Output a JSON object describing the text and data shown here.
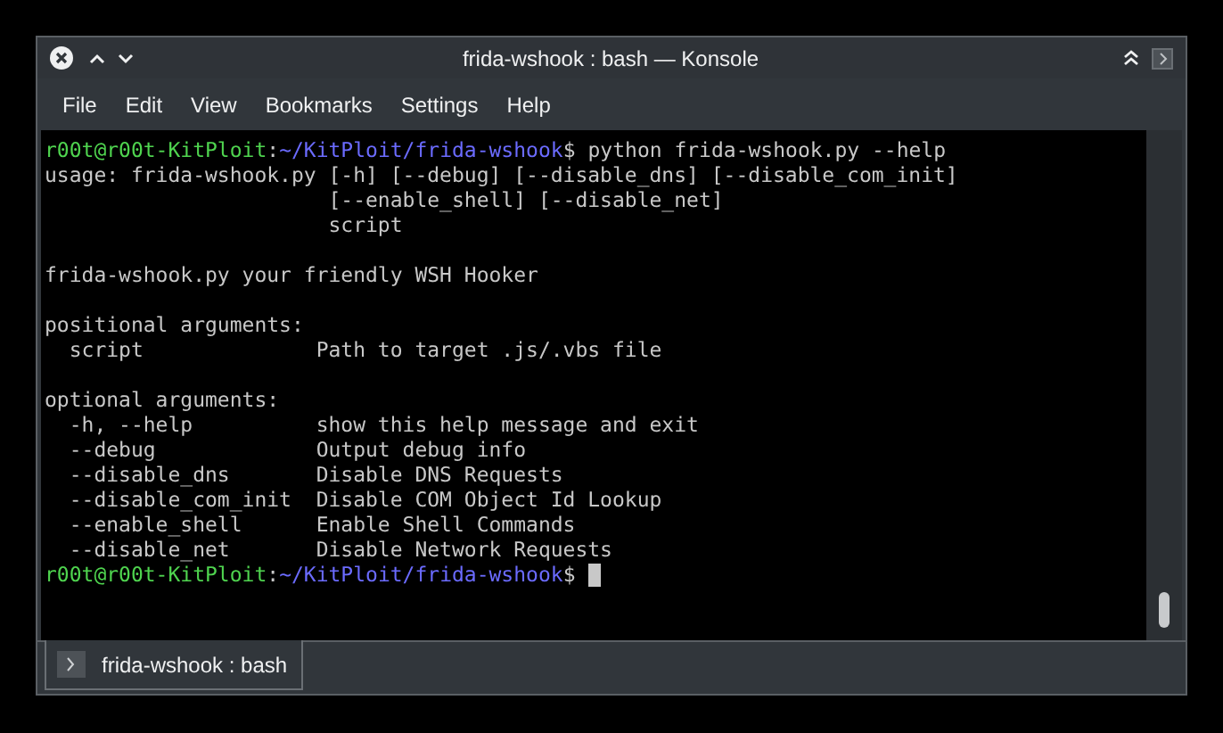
{
  "window": {
    "title": "frida-wshook : bash — Konsole"
  },
  "menu": [
    "File",
    "Edit",
    "View",
    "Bookmarks",
    "Settings",
    "Help"
  ],
  "terminal": {
    "lines": [
      {
        "kind": "prompt",
        "user_host": "r00t@r00t-KitPloit",
        "separator": ":",
        "path": "~/KitPloit/frida-wshook",
        "symbol": "$",
        "command": "python frida-wshook.py --help",
        "cursor": false
      },
      {
        "kind": "output",
        "text": "usage: frida-wshook.py [-h] [--debug] [--disable_dns] [--disable_com_init]"
      },
      {
        "kind": "output",
        "text": "                       [--enable_shell] [--disable_net]"
      },
      {
        "kind": "output",
        "text": "                       script"
      },
      {
        "kind": "blank"
      },
      {
        "kind": "output",
        "text": "frida-wshook.py your friendly WSH Hooker"
      },
      {
        "kind": "blank"
      },
      {
        "kind": "output",
        "text": "positional arguments:"
      },
      {
        "kind": "output",
        "text": "  script              Path to target .js/.vbs file"
      },
      {
        "kind": "blank"
      },
      {
        "kind": "output",
        "text": "optional arguments:"
      },
      {
        "kind": "output",
        "text": "  -h, --help          show this help message and exit"
      },
      {
        "kind": "output",
        "text": "  --debug             Output debug info"
      },
      {
        "kind": "output",
        "text": "  --disable_dns       Disable DNS Requests"
      },
      {
        "kind": "output",
        "text": "  --disable_com_init  Disable COM Object Id Lookup"
      },
      {
        "kind": "output",
        "text": "  --enable_shell      Enable Shell Commands"
      },
      {
        "kind": "output",
        "text": "  --disable_net       Disable Network Requests"
      },
      {
        "kind": "prompt",
        "user_host": "r00t@r00t-KitPloit",
        "separator": ":",
        "path": "~/KitPloit/frida-wshook",
        "symbol": "$",
        "cursor": true
      }
    ]
  },
  "tabs": [
    {
      "label": "frida-wshook : bash",
      "selected": true
    }
  ]
}
